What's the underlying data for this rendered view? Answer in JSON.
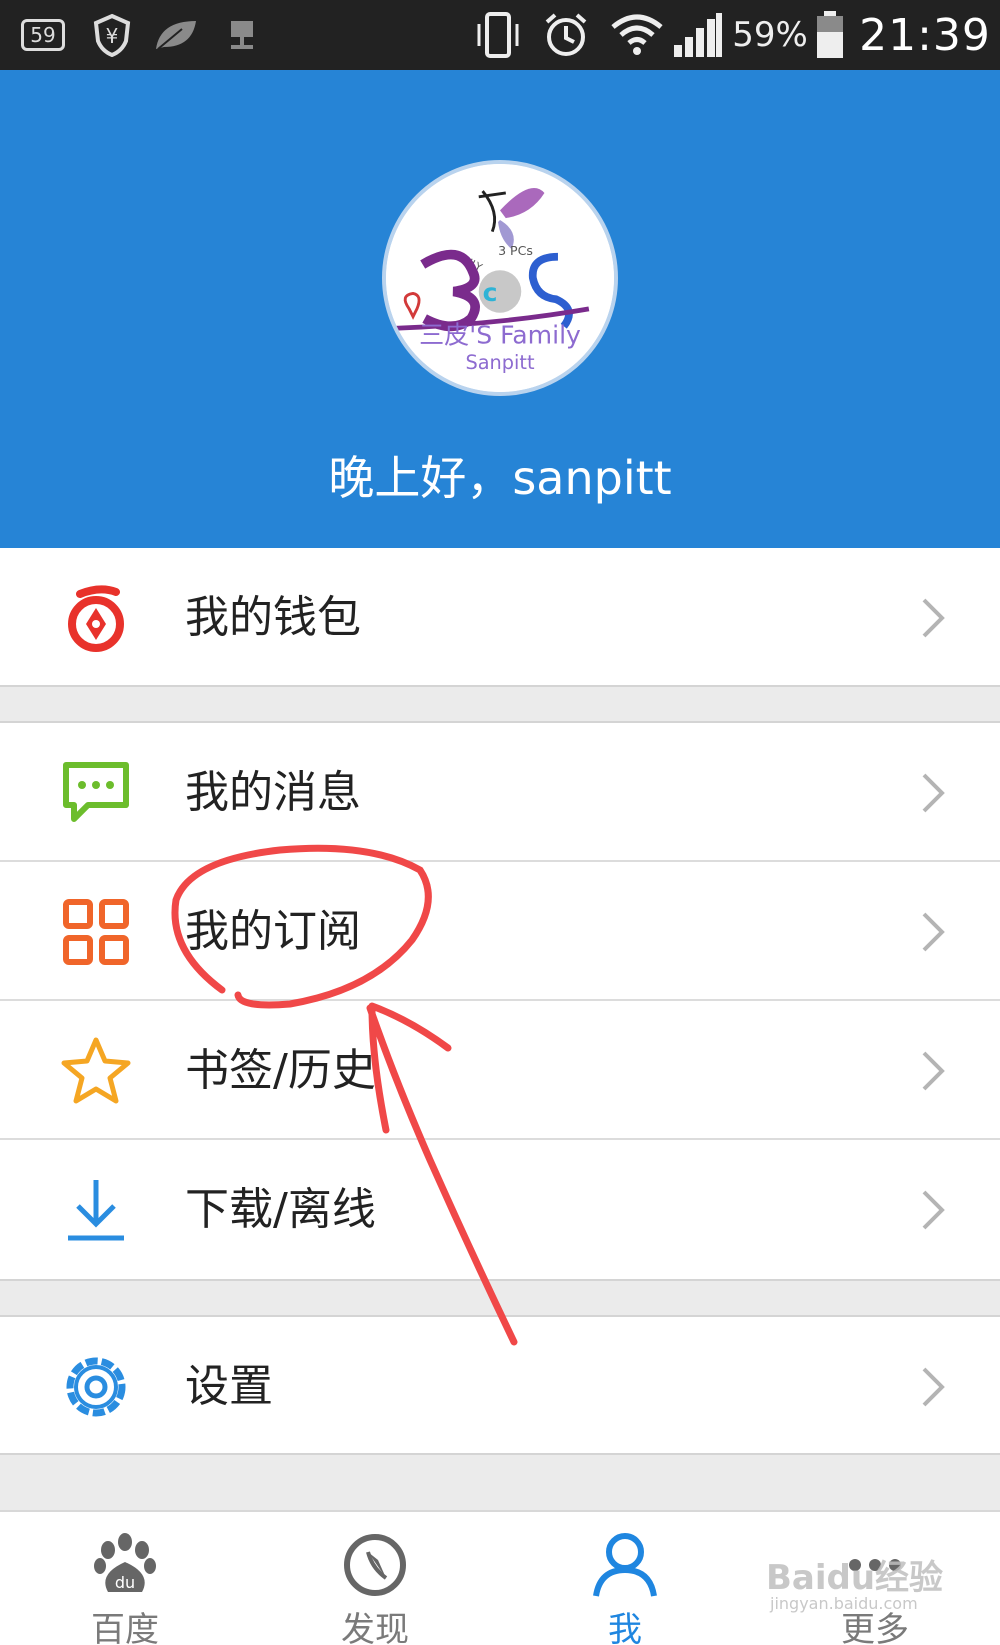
{
  "status_bar": {
    "badge": "59",
    "battery": "59%",
    "time": "21:39",
    "icons": [
      "notification-badge-icon",
      "yen-shield-icon",
      "leaf-icon",
      "network-icon",
      "vibrate-icon",
      "alarm-icon",
      "wifi-icon",
      "signal-icon",
      "battery-icon"
    ]
  },
  "header": {
    "background_color": "#2684d6",
    "greeting": "晚上好，sanpitt",
    "avatar": {
      "text_top": "ONLY 3 PCs",
      "text_brand": "三皮'S Family",
      "text_name": "Sanpitt"
    }
  },
  "menu": {
    "wallet": {
      "label": "我的钱包",
      "icon": "wallet-icon",
      "color": "#e8322b"
    },
    "messages": {
      "label": "我的消息",
      "icon": "message-icon",
      "color": "#6cbd2c"
    },
    "subscriptions": {
      "label": "我的订阅",
      "icon": "grid-icon",
      "color": "#f0652a"
    },
    "bookmarks": {
      "label": "书签/历史",
      "icon": "star-icon",
      "color": "#f5a623"
    },
    "downloads": {
      "label": "下载/离线",
      "icon": "download-icon",
      "color": "#2a8de0"
    },
    "settings": {
      "label": "设置",
      "icon": "gear-icon",
      "color": "#2a8de0"
    }
  },
  "bottom_nav": {
    "baidu": {
      "label": "百度",
      "icon": "baidu-paw-icon"
    },
    "discover": {
      "label": "发现",
      "icon": "compass-icon"
    },
    "me": {
      "label": "我",
      "icon": "person-icon",
      "active": true
    },
    "more": {
      "label": "更多",
      "icon": "more-icon"
    }
  },
  "watermark": {
    "brand": "Baidu经验",
    "sub": "jingyan.baidu.com"
  },
  "accent_color": "#1f86e0",
  "annotation_color": "#f04848"
}
